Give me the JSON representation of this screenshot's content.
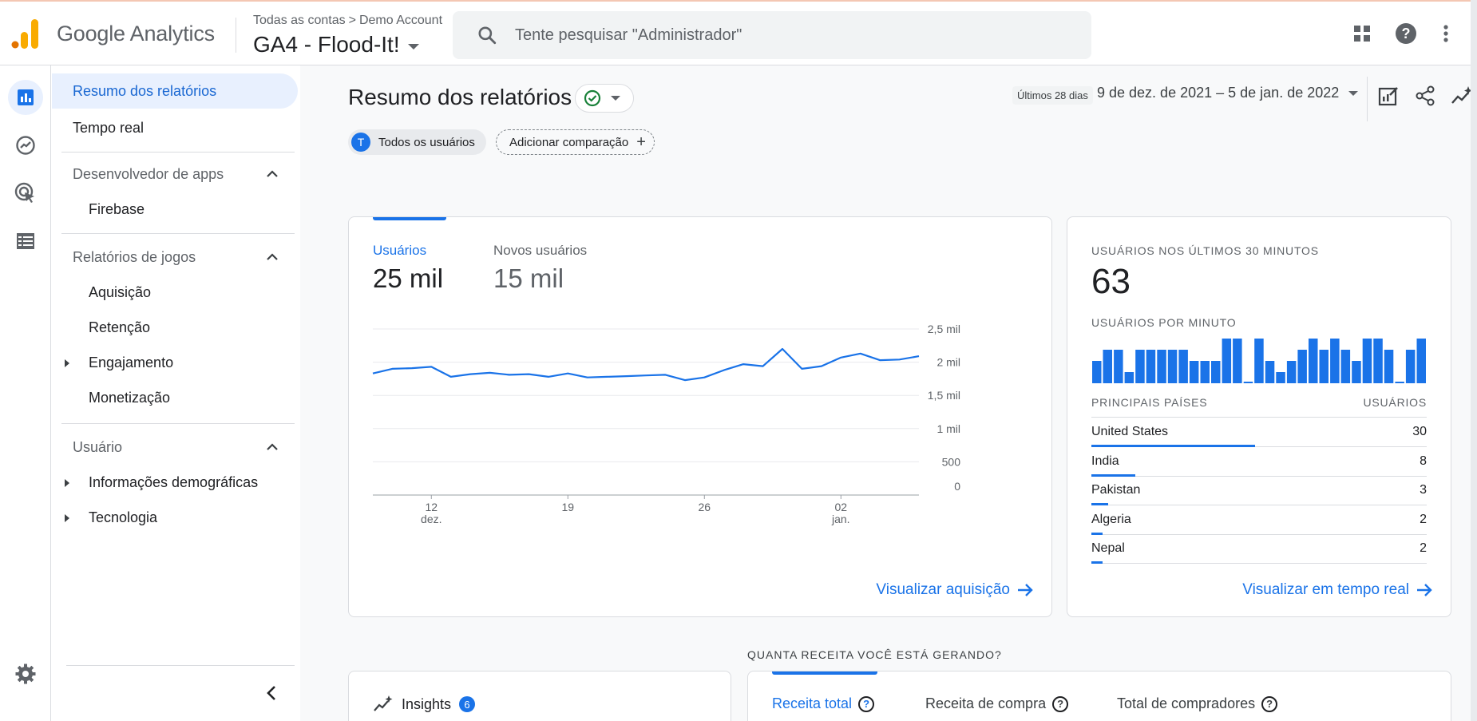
{
  "app": {
    "name": "Google Analytics",
    "breadcrumb": [
      "Todas as contas",
      "Demo Account"
    ],
    "property": "GA4 - Flood-It!",
    "search_placeholder": "Tente pesquisar \"Administrador\"",
    "brand_colors": {
      "logo_orange": "#f9ab00",
      "logo_dark_orange": "#e37400",
      "accent": "#1a73e8"
    }
  },
  "rail": {
    "icons": [
      "reports-icon",
      "explore-icon",
      "advertising-icon",
      "configure-icon",
      "settings-icon"
    ]
  },
  "nav": {
    "items": [
      {
        "label": "Resumo dos relatórios",
        "active": true
      },
      {
        "label": "Tempo real"
      }
    ],
    "sections": [
      {
        "title": "Desenvolvedor de apps",
        "items": [
          {
            "label": "Firebase"
          }
        ]
      },
      {
        "title": "Relatórios de jogos",
        "items": [
          {
            "label": "Aquisição"
          },
          {
            "label": "Retenção"
          },
          {
            "label": "Engajamento",
            "expandable": true
          },
          {
            "label": "Monetização"
          }
        ]
      },
      {
        "title": "Usuário",
        "items": [
          {
            "label": "Informações demográficas",
            "expandable": true
          },
          {
            "label": "Tecnologia",
            "expandable": true
          }
        ]
      }
    ]
  },
  "header": {
    "title": "Resumo dos relatórios",
    "date_label": "Últimos 28 dias",
    "date_range": "9 de dez. de 2021 – 5 de jan. de 2022",
    "chip_user_initial": "T",
    "chip_user": "Todos os usuários",
    "chip_add": "Adicionar comparação"
  },
  "summary": {
    "metric1_label": "Usuários",
    "metric1_value": "25 mil",
    "metric2_label": "Novos usuários",
    "metric2_value": "15 mil",
    "link": "Visualizar aquisição"
  },
  "chart_data": {
    "type": "line",
    "series": [
      {
        "values": [
          1.83,
          1.9,
          1.91,
          1.93,
          1.78,
          1.82,
          1.84,
          1.81,
          1.82,
          1.78,
          1.83,
          1.77,
          1.78,
          1.79,
          1.8,
          1.81,
          1.73,
          1.77,
          1.88,
          1.97,
          1.94,
          2.2,
          1.9,
          1.94,
          2.07,
          2.13,
          2.03,
          2.04,
          2.09
        ]
      }
    ],
    "x_ticks": [
      {
        "label": "12",
        "sublabel": "dez.",
        "index": 3
      },
      {
        "label": "19",
        "index": 10
      },
      {
        "label": "26",
        "index": 17
      },
      {
        "label": "02",
        "sublabel": "jan.",
        "index": 24
      }
    ],
    "y_ticks": [
      {
        "label": "2,5 mil",
        "value": 2.5
      },
      {
        "label": "2 mil",
        "value": 2.0
      },
      {
        "label": "1,5 mil",
        "value": 1.5
      },
      {
        "label": "1 mil",
        "value": 1.0
      },
      {
        "label": "500",
        "value": 0.5
      },
      {
        "label": "0",
        "value": 0
      }
    ],
    "ylim": [
      0,
      2.5
    ],
    "grid": true,
    "line_color": "#1a73e8"
  },
  "realtime": {
    "heading": "USUÁRIOS NOS ÚLTIMOS 30 MINUTOS",
    "value": "63",
    "per_minute_heading": "USUÁRIOS POR MINUTO",
    "per_minute_bars": [
      2,
      3,
      3,
      1,
      3,
      3,
      3,
      3,
      3,
      2,
      2,
      2,
      4,
      4,
      0,
      4,
      2,
      1,
      2,
      3,
      4,
      3,
      4,
      3,
      2,
      4,
      4,
      3,
      0,
      3,
      4
    ],
    "countries_header": "PRINCIPAIS PAÍSES",
    "users_header": "USUÁRIOS",
    "countries": [
      {
        "name": "United States",
        "value": "30",
        "share": 1.0
      },
      {
        "name": "India",
        "value": "8",
        "share": 0.27
      },
      {
        "name": "Pakistan",
        "value": "3",
        "share": 0.1
      },
      {
        "name": "Algeria",
        "value": "2",
        "share": 0.067
      },
      {
        "name": "Nepal",
        "value": "2",
        "share": 0.067
      }
    ],
    "link": "Visualizar em tempo real"
  },
  "revenue": {
    "section_title": "QUANTA RECEITA VOCÊ ESTÁ GERANDO?",
    "insights_label": "Insights",
    "insights_count": "6",
    "tabs": [
      "Receita total",
      "Receita de compra",
      "Total de compradores"
    ]
  }
}
